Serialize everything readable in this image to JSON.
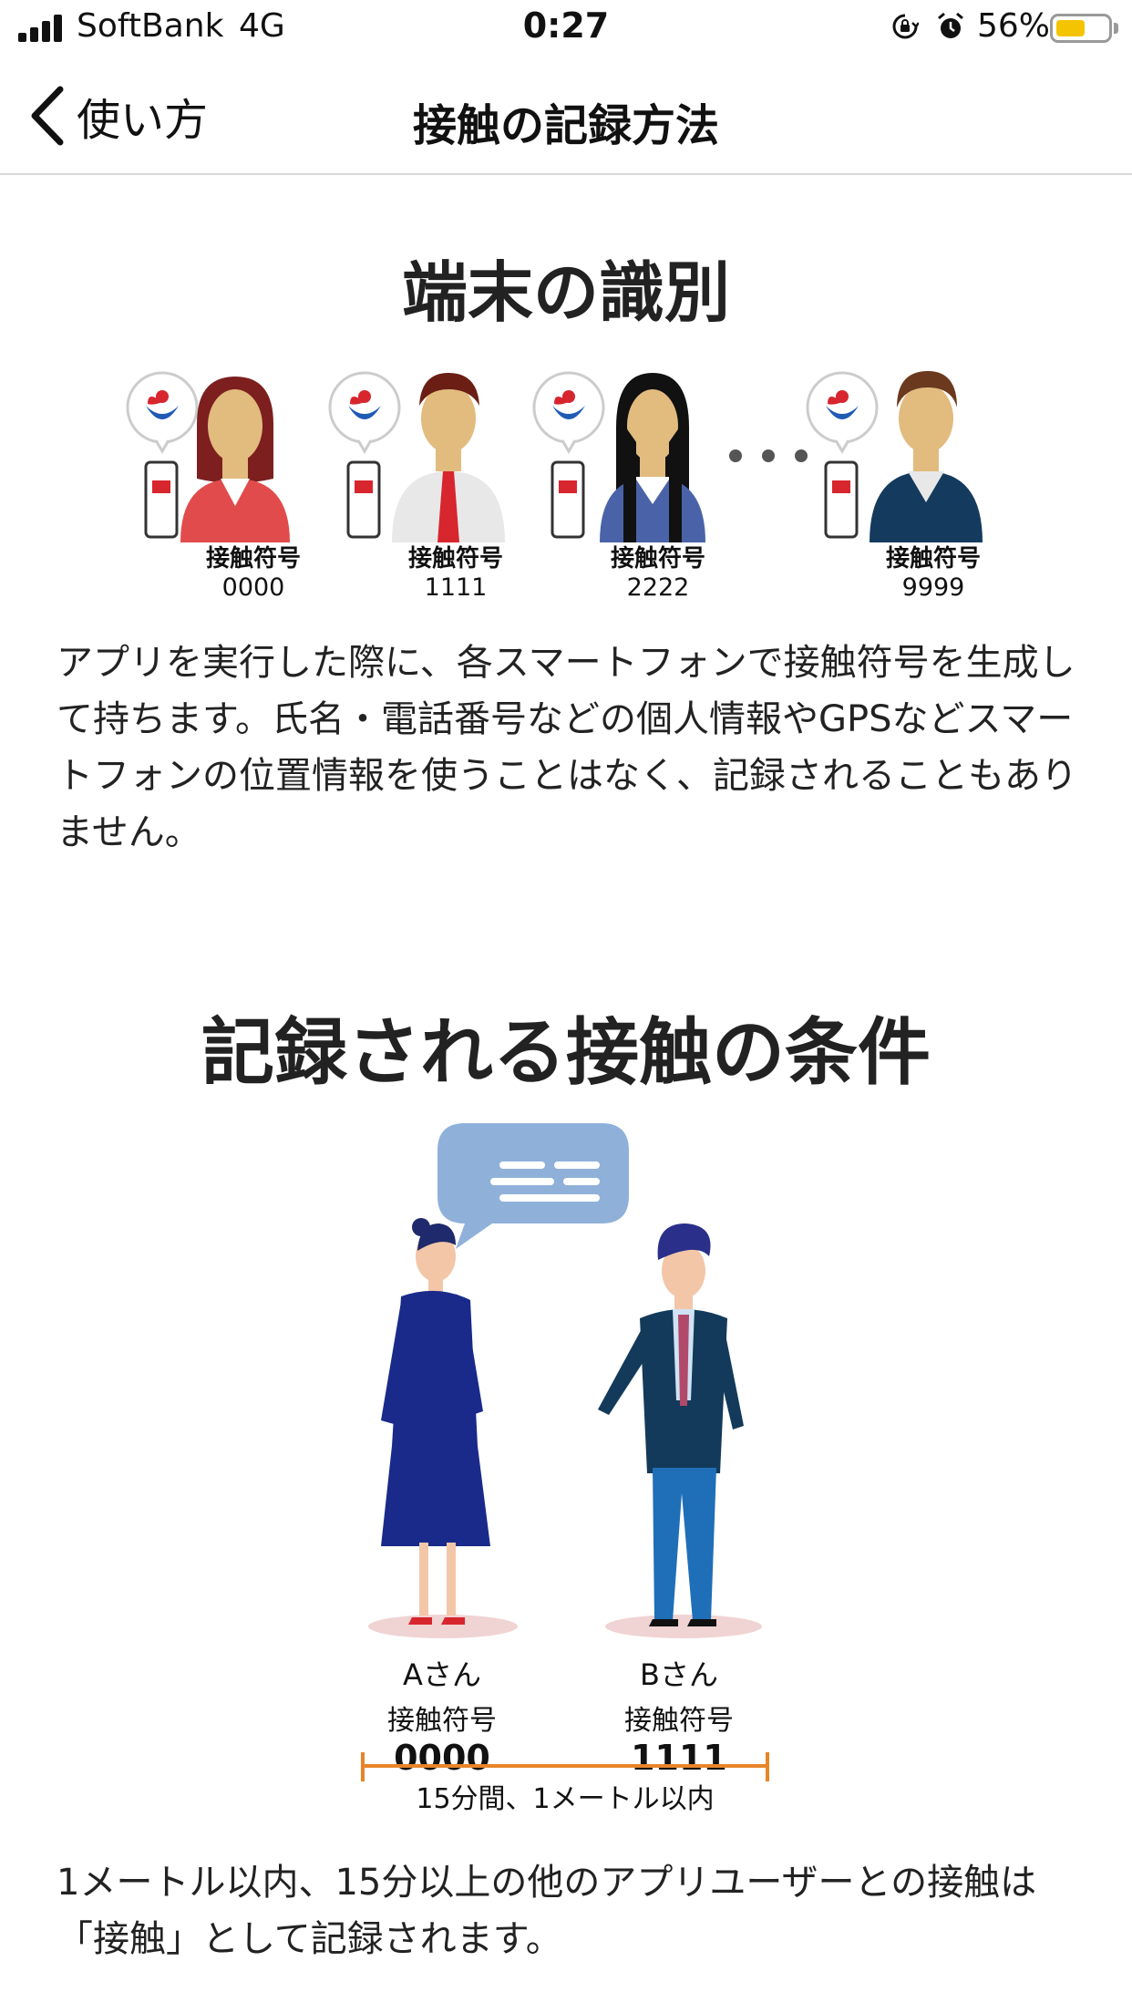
{
  "status_bar": {
    "carrier": "SoftBank",
    "network": "4G",
    "time": "0:27",
    "battery_percent_label": "56%",
    "battery_level": 0.56,
    "icons": [
      "signal-icon",
      "rotation-lock-icon",
      "alarm-icon",
      "battery-icon"
    ]
  },
  "nav": {
    "back_label": "使い方",
    "title": "接触の記録方法"
  },
  "section_identify": {
    "heading": "端末の識別",
    "devices": [
      {
        "code_label": "接触符号",
        "code": "0000"
      },
      {
        "code_label": "接触符号",
        "code": "1111"
      },
      {
        "code_label": "接触符号",
        "code": "2222"
      },
      {
        "code_label": "接触符号",
        "code": "9999"
      }
    ],
    "description": "アプリを実行した際に、各スマートフォンで接触符号を生成して持ちます。氏名・電話番号などの個人情報やGPSなどスマートフォンの位置情報を使うことはなく、記録されることもありません。"
  },
  "section_conditions": {
    "heading": "記録される接触の条件",
    "person_a": {
      "name": "Aさん",
      "code_label": "接触符号",
      "code": "0000"
    },
    "person_b": {
      "name": "Bさん",
      "code_label": "接触符号",
      "code": "1111"
    },
    "range_label": "15分間、1メートル以内",
    "description": "1メートル以内、15分以上の他のアプリユーザーとの接触は「接触」として記録されます。"
  },
  "colors": {
    "accent_orange": "#e8842a",
    "battery_yellow": "#f5c400",
    "logo_red": "#d7262e",
    "logo_blue": "#1f5bb5"
  }
}
